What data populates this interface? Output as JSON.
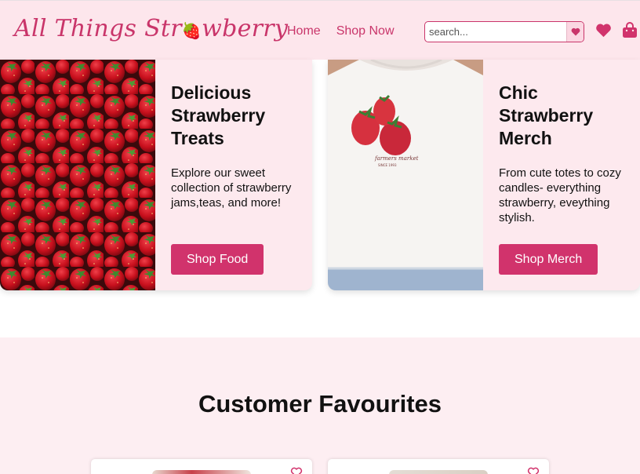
{
  "header": {
    "logo_before": "All Things Str",
    "logo_after": "wberry",
    "nav": {
      "home": "Home",
      "shop_now": "Shop Now"
    },
    "search": {
      "placeholder": "search...",
      "button_icon": "heart-icon"
    },
    "icons": {
      "wishlist": "heart-icon",
      "cart": "shopping-bag-icon"
    }
  },
  "cards": {
    "food": {
      "image": "strawberries-photo",
      "title": "Delicious Strawberry Treats",
      "description": "Explore our sweet collection of strawberry jams,teas, and more!",
      "button": "Shop Food"
    },
    "merch": {
      "image": "strawberry-tshirt-photo",
      "title": "Chic Strawberry Merch",
      "description": "From cute totes to cozy candles- everything strawberry, eveything stylish.",
      "button": "Shop Merch"
    }
  },
  "favourites": {
    "title": "Customer Favourites"
  },
  "colors": {
    "accent": "#d1336c",
    "brand_text": "#c9356a",
    "header_bg": "#fde6ec",
    "card_bg": "#fde9ee",
    "section_bg": "#fdeef2"
  }
}
